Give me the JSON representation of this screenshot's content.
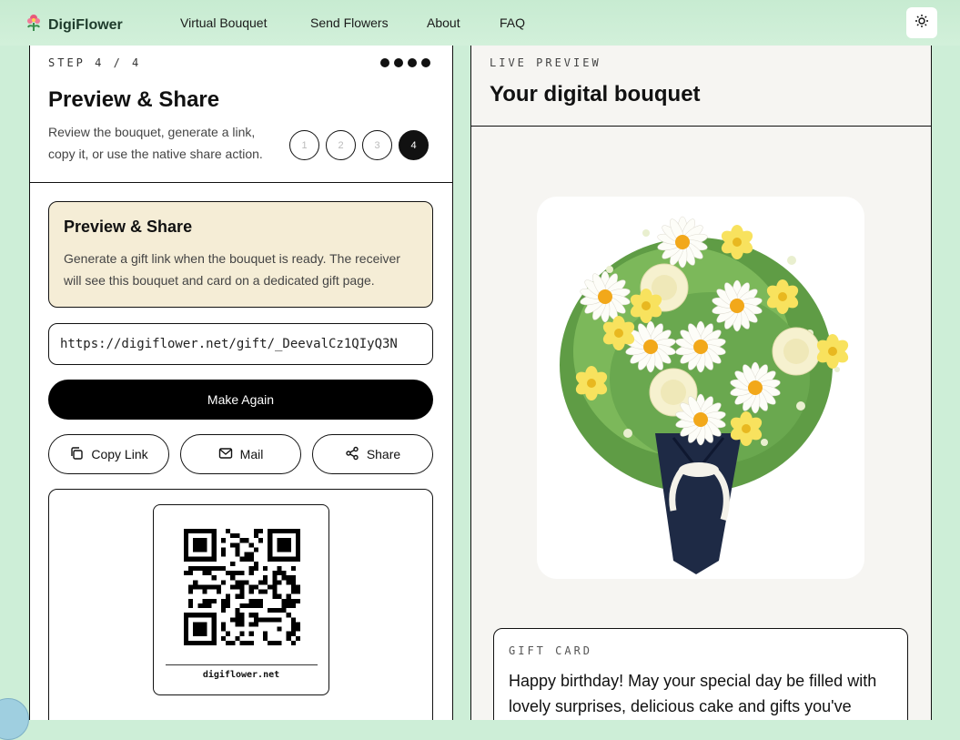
{
  "nav": {
    "brand": "DigiFlower",
    "links": [
      "Virtual Bouquet",
      "Send Flowers",
      "About",
      "FAQ"
    ],
    "logo_icon": "flower-logo-icon",
    "theme_icon": "sun-icon"
  },
  "left": {
    "step_label": "STEP 4 / 4",
    "title": "Preview & Share",
    "description": "Review the bouquet, generate a link, copy it, or use the native share action.",
    "steps": [
      "1",
      "2",
      "3",
      "4"
    ],
    "active_step": "4",
    "info": {
      "title": "Preview & Share",
      "text": "Generate a gift link when the bouquet is ready. The receiver will see this bouquet and card on a dedicated gift page."
    },
    "link_value": "https://digiflower.net/gift/_DeevalCz1QIyQ3N",
    "make_again": "Make Again",
    "copy_link": "Copy Link",
    "mail": "Mail",
    "share": "Share",
    "qr_caption": "digiflower.net"
  },
  "right": {
    "live_label": "LIVE PREVIEW",
    "title": "Your digital bouquet",
    "gift_card_label": "GIFT CARD",
    "gift_message": "Happy birthday! May your special day be filled with lovely surprises, delicious cake and gifts you've"
  },
  "colors": {
    "background": "#cdeed7",
    "accent": "#000000",
    "info_box": "#f5edd6"
  }
}
